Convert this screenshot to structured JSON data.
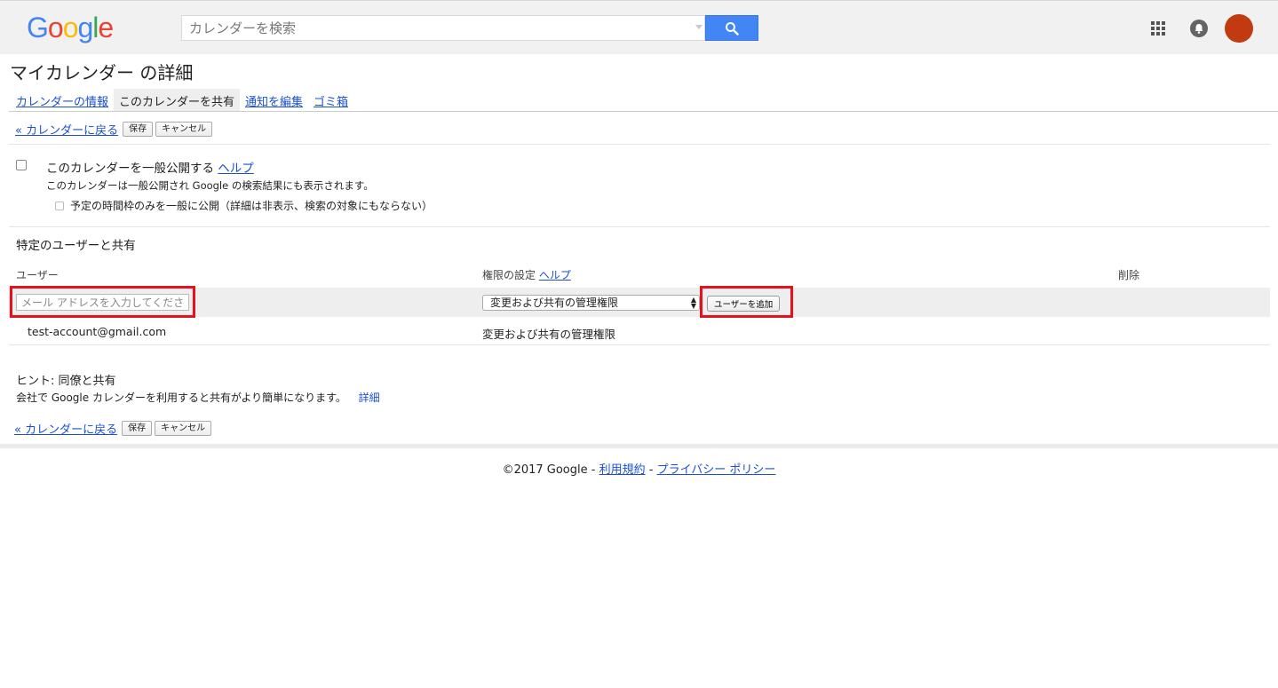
{
  "header": {
    "logo": {
      "letters": [
        "G",
        "o",
        "o",
        "g",
        "l",
        "e"
      ],
      "colors": [
        "#4285f4",
        "#ea4335",
        "#fbbc05",
        "#4285f4",
        "#34a853",
        "#ea4335"
      ]
    },
    "search_placeholder": "カレンダーを検索",
    "search_button_icon": "search-icon",
    "apps_icon": "apps-grid-icon",
    "notifications_icon": "bell-icon",
    "avatar_color": "#c23a0f",
    "accent_color": "#4285f4"
  },
  "page": {
    "title": "マイカレンダー の詳細",
    "tabs": [
      {
        "label": "カレンダーの情報",
        "active": false
      },
      {
        "label": "このカレンダーを共有",
        "active": true
      },
      {
        "label": "通知を編集",
        "active": false
      },
      {
        "label": "ゴミ箱",
        "active": false
      }
    ],
    "back_link": "« カレンダーに戻る",
    "save_label": "保存",
    "cancel_label": "キャンセル"
  },
  "public": {
    "checkbox_label": "このカレンダーを一般公開する",
    "help_link": "ヘルプ",
    "description": "このカレンダーは一般公開され Google の検索結果にも表示されます。",
    "free_busy_label": "予定の時間枠のみを一般に公開（詳細は非表示、検索の対象にもならない）"
  },
  "sharing": {
    "section_title": "特定のユーザーと共有",
    "col_user": "ユーザー",
    "col_permission": "権限の設定",
    "col_permission_help": "ヘルプ",
    "col_delete": "削除",
    "email_placeholder": "メール アドレスを入力してください",
    "permission_selected": "変更および共有の管理権限",
    "add_button": "ユーザーを追加",
    "rows": [
      {
        "user": "test-account@gmail.com",
        "permission": "変更および共有の管理権限"
      }
    ]
  },
  "hint": {
    "title": "ヒント: 同僚と共有",
    "text": "会社で Google カレンダーを利用すると共有がより簡単になります。",
    "link": "詳細"
  },
  "footer": {
    "copyright": "©2017 Google - ",
    "terms": "利用規約",
    "separator": " - ",
    "privacy": "プライバシー ポリシー"
  },
  "highlight_color": "#e8101c"
}
